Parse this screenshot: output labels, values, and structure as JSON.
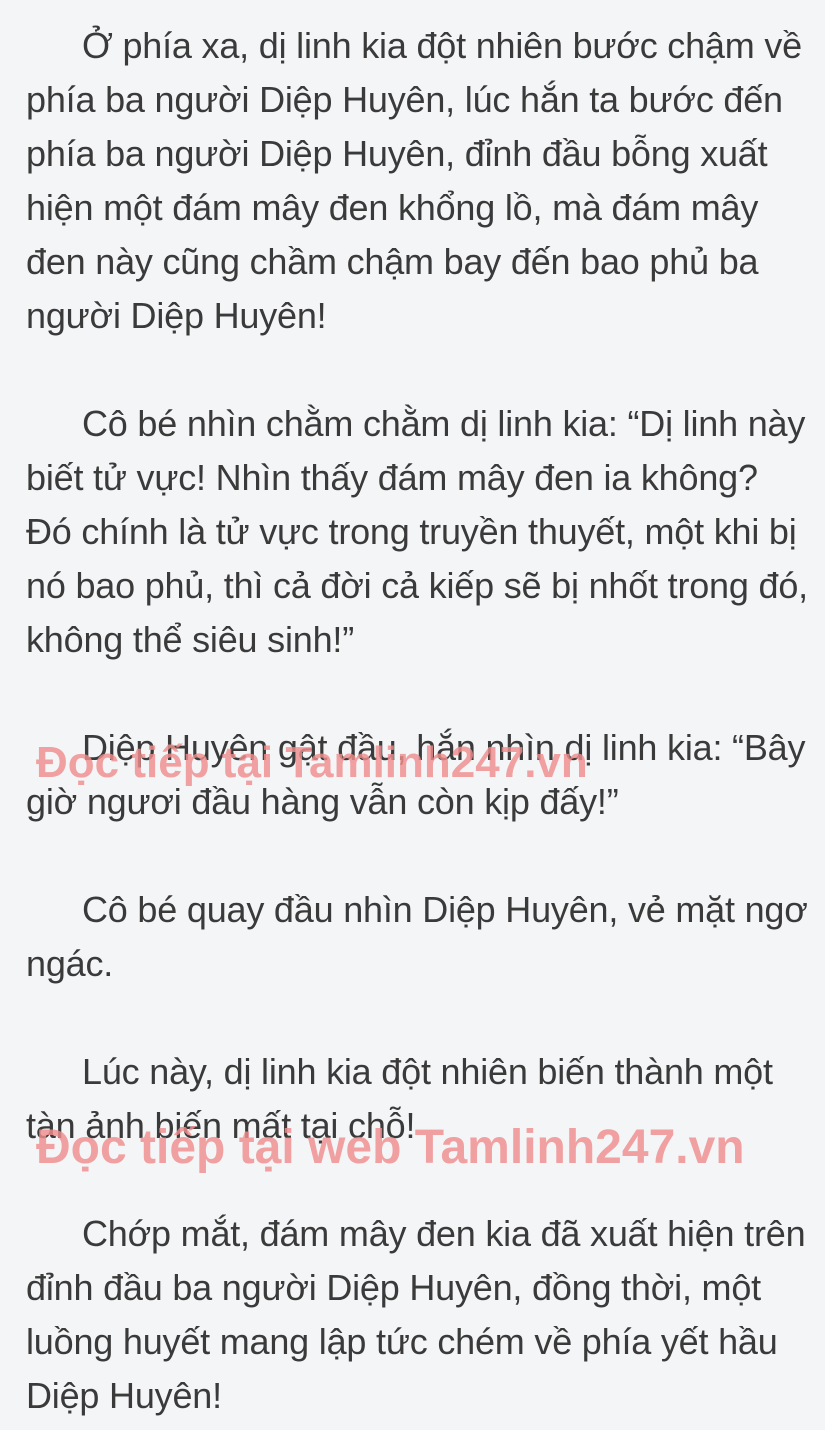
{
  "paragraphs": [
    "Ở phía xa, dị linh kia đột nhiên bước chậm về phía ba người Diệp Huyên, lúc hắn ta bước đến phía ba người Diệp Huyên, đỉnh đầu bỗng xuất hiện một đám mây đen khổng lồ, mà đám mây đen này cũng chầm chậm bay đến bao phủ ba người Diệp Huyên!",
    "Cô bé nhìn chằm chằm dị linh kia: “Dị linh này biết tử vực! Nhìn thấy đám mây đen ia không? Đó chính là tử vực trong truyền thuyết, một khi bị nó bao phủ, thì cả đời cả kiếp sẽ bị nhốt trong đó, không thể siêu sinh!”",
    "Diệp Huyên gật đầu, hắn nhìn dị linh kia: “Bây giờ ngươi đầu hàng vẫn còn kịp đấy!”",
    "Cô bé quay đầu nhìn Diệp Huyên, vẻ mặt ngơ ngác.",
    "Lúc này, dị linh kia đột nhiên biến thành một tàn ảnh biến mất tại chỗ!",
    "Chớp mắt, đám mây đen kia đã xuất hiện trên đỉnh đầu ba người Diệp Huyên, đồng thời, một luồng huyết mang lập tức chém về phía yết hầu Diệp Huyên!"
  ],
  "watermarks": [
    "Đọc tiếp tại Tamlinh247.vn",
    "Đọc tiếp tại web Tamlinh247.vn"
  ]
}
